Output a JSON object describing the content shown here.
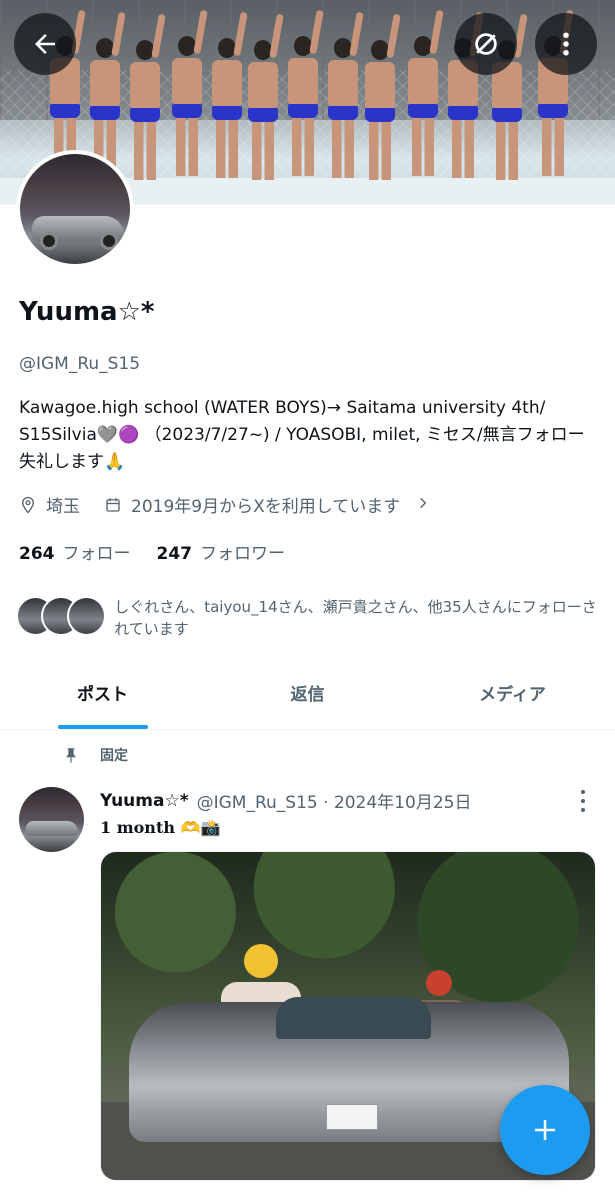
{
  "profile": {
    "name": "Yuuma☆*",
    "handle": "@IGM_Ru_S15",
    "bio": "Kawagoe.high school (WATER BOYS)→ Saitama university 4th/ S15Silvia🩶🟣 （2023/7/27~) / YOASOBI, milet, ミセス/無言フォロー失礼します🙏",
    "location": "埼玉",
    "joined": "2019年9月からXを利用しています",
    "following_count": "264",
    "following_label": "フォロー",
    "followers_count": "247",
    "followers_label": "フォロワー",
    "followed_by_text": "しぐれさん、taiyou_14さん、瀬戸貴之さん、他35人さんにフォローされています"
  },
  "tabs": [
    {
      "label": "ポスト",
      "active": true
    },
    {
      "label": "返信",
      "active": false
    },
    {
      "label": "メディア",
      "active": false
    }
  ],
  "post": {
    "pinned_label": "固定",
    "author_name": "Yuuma☆*",
    "author_handle_date": "@IGM_Ru_S15 · 2024年10月25日",
    "text": "1 month 🫶📸"
  },
  "colors": {
    "accent": "#1d9bf0",
    "text_primary": "#0f1419",
    "text_secondary": "#536471"
  },
  "icons": {
    "back": "arrow-left-icon",
    "translate": "no-translate-icon",
    "more": "more-vertical-icon",
    "location": "location-pin-icon",
    "calendar": "calendar-icon",
    "pin": "pin-icon",
    "compose": "plus-icon"
  }
}
